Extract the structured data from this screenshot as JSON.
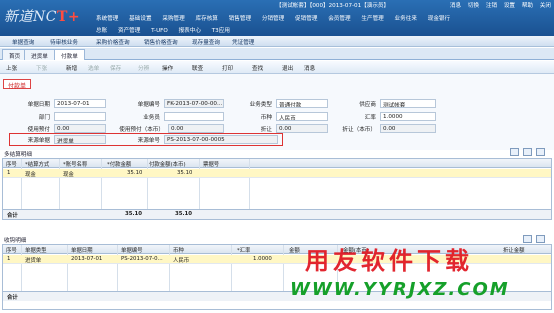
{
  "header": {
    "logo": "新道NC",
    "logo_suffix": "T+",
    "account_info": "【测试帐套】【000】2013-07-01【演示员】",
    "links": [
      "消息",
      "切换",
      "注销",
      "设置",
      "帮助",
      "关闭"
    ],
    "menu_row1": [
      "系统管理",
      "基础设置",
      "采购管理",
      "库存核算",
      "销售管理",
      "分销管理",
      "促销管理",
      "会员管理",
      "生产管理",
      "业务往来",
      "现金银行"
    ],
    "menu_row2": [
      "总账",
      "资产管理",
      "T-UFO",
      "报表中心",
      "T3应用"
    ]
  },
  "quickbar": [
    "单据查询",
    "待审核业务",
    "采购价格查询",
    "销售价格查询",
    "现存量查询",
    "凭证管理"
  ],
  "tabs": [
    "首页",
    "进货单",
    "付款单"
  ],
  "actions": [
    "上张",
    "下张",
    "新增",
    "选单",
    "保存",
    "分辨",
    "操作",
    "联查",
    "打印",
    "查找",
    "退出",
    "消息"
  ],
  "doc_title": "付款单",
  "form": {
    "doc_date_label": "单据日期",
    "doc_date": "2013-07-01",
    "doc_no_label": "单据编号",
    "doc_no": "FK-2013-07-00-00...",
    "biz_type_label": "业务类型",
    "biz_type": "普通付款",
    "supplier_label": "供应商",
    "supplier": "测试帐套",
    "dept_label": "部门",
    "dept": "",
    "clerk_label": "业务员",
    "clerk": "",
    "currency_label": "币种",
    "currency": "人民币",
    "rate_label": "汇率",
    "rate": "1.0000",
    "prepay_label": "使用预付",
    "prepay": "0.00",
    "prepay_local_label": "使用预付（本币）",
    "prepay_local": "0.00",
    "discount_label": "折让",
    "discount": "0.00",
    "discount_local_label": "折让（本币）",
    "discount_local": "0.00",
    "source_type_label": "来源单据",
    "source_type": "进货单",
    "source_no_label": "来源单号",
    "source_no": "PS-2013-07-00-0005"
  },
  "settle_grid": {
    "title": "多结算明细",
    "headers": [
      "序号",
      "*结算方式",
      "*账号名称",
      "*付款金额",
      "付款金额(本币)",
      "票据号"
    ],
    "rows": [
      [
        "1",
        "现金",
        "现金",
        "35.10",
        "35.10",
        ""
      ]
    ],
    "total_label": "合计",
    "totals": [
      "35.10",
      "35.10"
    ]
  },
  "detail_grid": {
    "title": "收钩明细",
    "headers": [
      "序号",
      "单据类型",
      "单据日期",
      "单据编号",
      "币种",
      "*汇率",
      "金额",
      "金额(本币)",
      "折让金额"
    ],
    "rows": [
      [
        "1",
        "进货单",
        "2013-07-01",
        "PS-2013-07-0...",
        "人民币",
        "1.0000",
        "",
        "",
        ""
      ]
    ],
    "total_label": "合计"
  },
  "watermark": {
    "line1": "用友软件下载",
    "line2": "WWW.YYRJXZ.COM"
  },
  "colors": {
    "header_blue": "#1a5191",
    "highlight_red": "#d33333",
    "watermark_red": "#e0141e",
    "watermark_green": "#16a02a"
  }
}
